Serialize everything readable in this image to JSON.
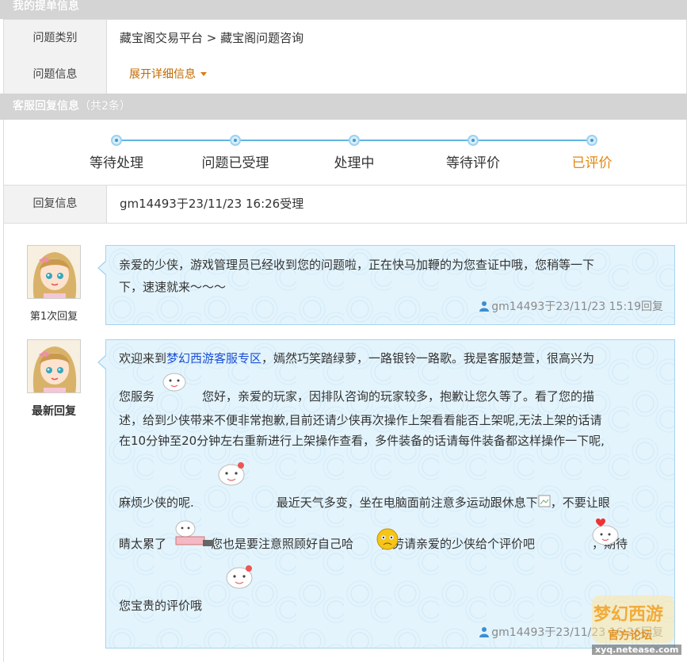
{
  "sections": {
    "order_info_title": "我的提单信息",
    "reply_info_title": "客服回复信息",
    "reply_info_count": "（共2条）"
  },
  "order": {
    "category_label": "问题类别",
    "category_value": "藏宝阁交易平台 > 藏宝阁问题咨询",
    "info_label": "问题信息",
    "info_expand": "展开详细信息"
  },
  "progress": {
    "steps": [
      "等待处理",
      "问题已受理",
      "处理中",
      "等待评价",
      "已评价"
    ],
    "active_index": 4
  },
  "reply_info": {
    "label": "回复信息",
    "value": "gm14493于23/11/23 16:26受理"
  },
  "replies": [
    {
      "caption": "第1次回复",
      "line1": "亲爱的少侠，游戏管理员已经收到您的问题啦，正在快马加鞭的为您查证中哦，您稍等一下",
      "line2": "下，速速就来～～～",
      "meta": "gm14493于23/11/23 15:19回复"
    },
    {
      "caption": "最新回复",
      "p1_pre": "欢迎来到",
      "p1_link": "梦幻西游客服专区",
      "p1_post": "，嫣然巧笑踏绿萝，一路银铃一路歌。我是客服楚萱，很高兴为",
      "p2_pre": "您服务",
      "p2_post": "您好，亲爱的玩家，因排队咨询的玩家较多，抱歉让您久等了。看了您的描",
      "p3": "述，给到少侠带来不便非常抱歉,目前还请少侠再次操作上架看看能否上架呢,无法上架的话请",
      "p4": "在10分钟至20分钟左右重新进行上架操作查看，多件装备的话请每件装备都这样操作一下呢,",
      "p5_pre": "麻烦少侠的呢.",
      "p5_post": "最近天气多变，坐在电脑面前注意多运动跟休息下",
      "p5_end": "，不要让眼",
      "p6_pre": "睛太累了",
      "p6_mid": "您也是要注意照顾好自己哈",
      "p6_post": "，劳请亲爱的少侠给个评价吧",
      "p6_end": "，期待",
      "p7": "您宝贵的评价哦",
      "meta": "gm14493于23/11/23 16:26回复"
    }
  ],
  "watermark": {
    "logo_text": "梦幻西游",
    "sub_text": "官方论坛",
    "url": "xyq.netease.com"
  },
  "colors": {
    "header_bg": "#d4d4d4",
    "accent_orange": "#e0870f",
    "link_blue": "#1a4fd6",
    "bubble_bg": "#e4f4fc"
  }
}
